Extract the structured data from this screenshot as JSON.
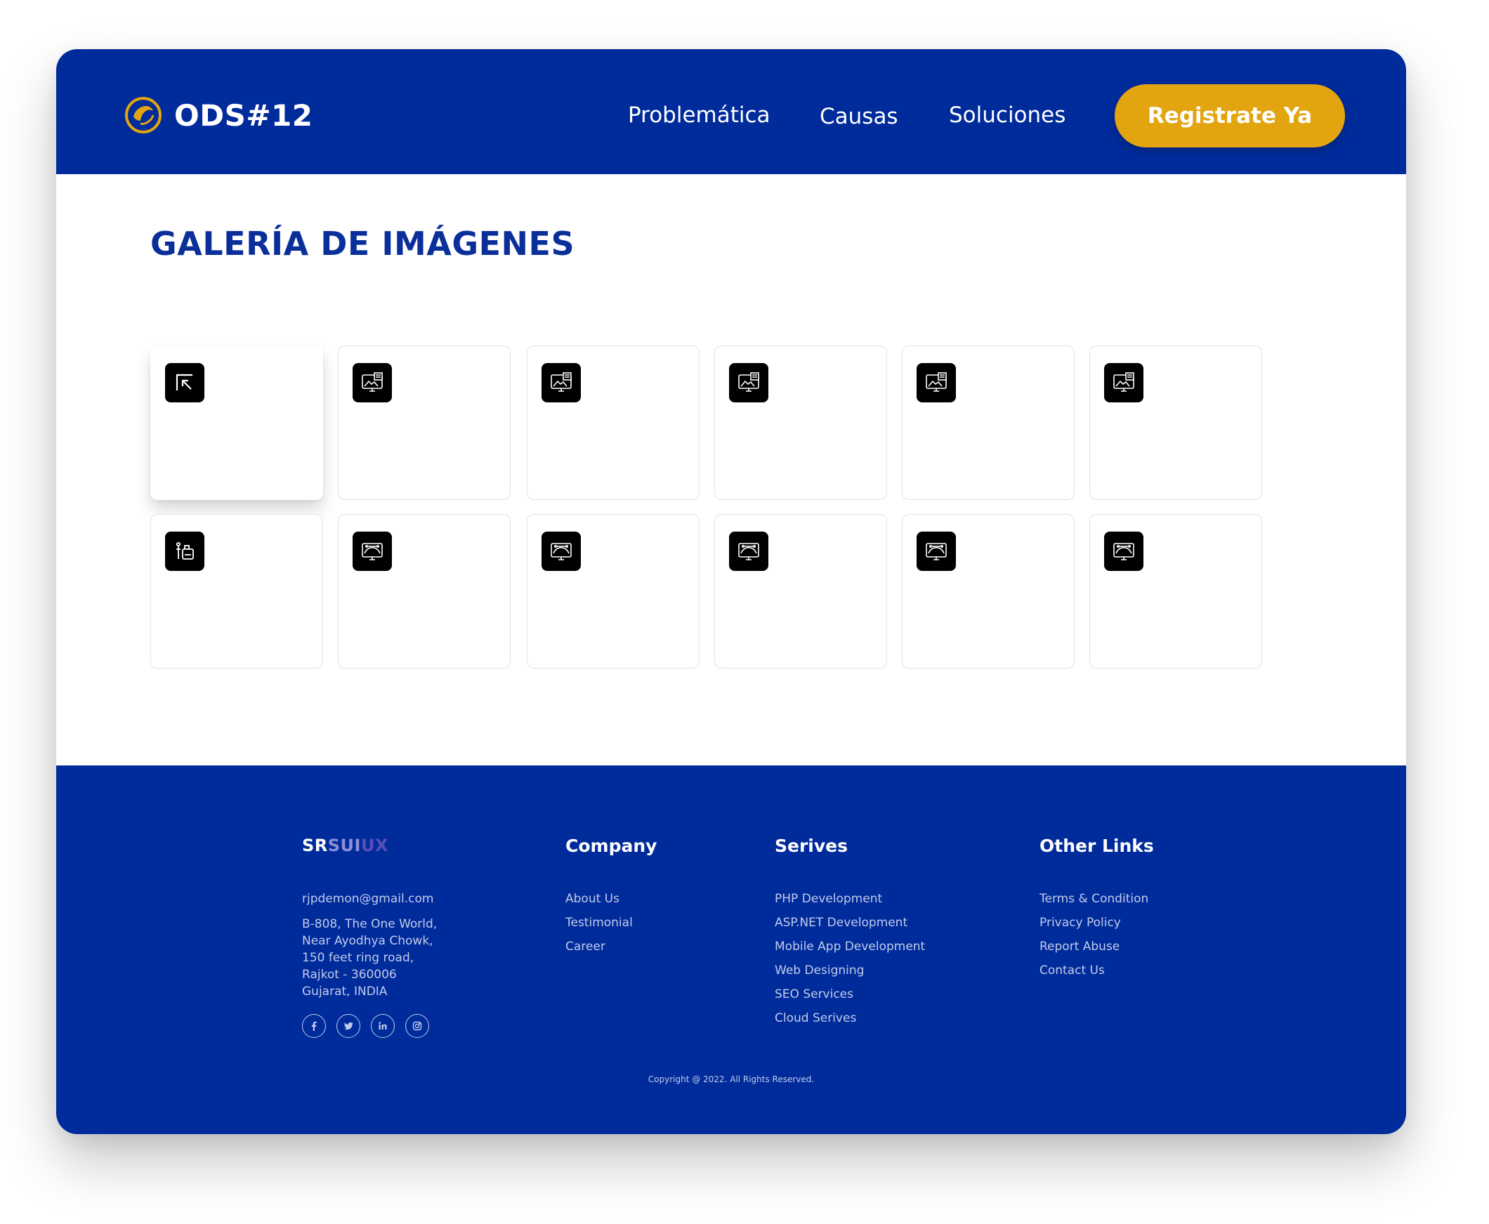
{
  "header": {
    "brand": "ODS#12",
    "nav": [
      "Problemática",
      "Causas",
      "Soluciones"
    ],
    "cta": "Registrate Ya"
  },
  "main": {
    "title": "GALERÍA DE IMÁGENES",
    "gallery": {
      "row1_icons": [
        "cursor-arrow-icon",
        "monitor-gallery-icon",
        "monitor-gallery-icon",
        "monitor-gallery-icon",
        "monitor-gallery-icon",
        "monitor-gallery-icon"
      ],
      "row2_icons": [
        "paint-tools-icon",
        "monitor-curve-icon",
        "monitor-curve-icon",
        "monitor-curve-icon",
        "monitor-curve-icon",
        "monitor-curve-icon"
      ]
    }
  },
  "footer": {
    "brand_parts": [
      "SR",
      "SUI",
      "UX"
    ],
    "email": "rjpdemon@gmail.com",
    "address": [
      "B-808, The One World,",
      "Near Ayodhya Chowk,",
      "150 feet ring road,",
      "Rajkot - 360006",
      "Gujarat, INDIA"
    ],
    "social": [
      "facebook-icon",
      "twitter-icon",
      "linkedin-icon",
      "instagram-icon"
    ],
    "company": {
      "heading": "Company",
      "links": [
        "About Us",
        "Testimonial",
        "Career"
      ]
    },
    "services": {
      "heading": "Serives",
      "links": [
        "PHP Development",
        "ASP.NET Development",
        "Mobile App Development",
        "Web Designing",
        "SEO Services",
        "Cloud Serives"
      ]
    },
    "other": {
      "heading": "Other Links",
      "links": [
        "Terms & Condition",
        "Privacy Policy",
        "Report Abuse",
        "Contact Us"
      ]
    },
    "copyright": "Copyright @  2022. All Rights Reserved."
  },
  "colors": {
    "primary": "#002b9b",
    "accent": "#e2a50f",
    "title": "#0a2f9a"
  }
}
